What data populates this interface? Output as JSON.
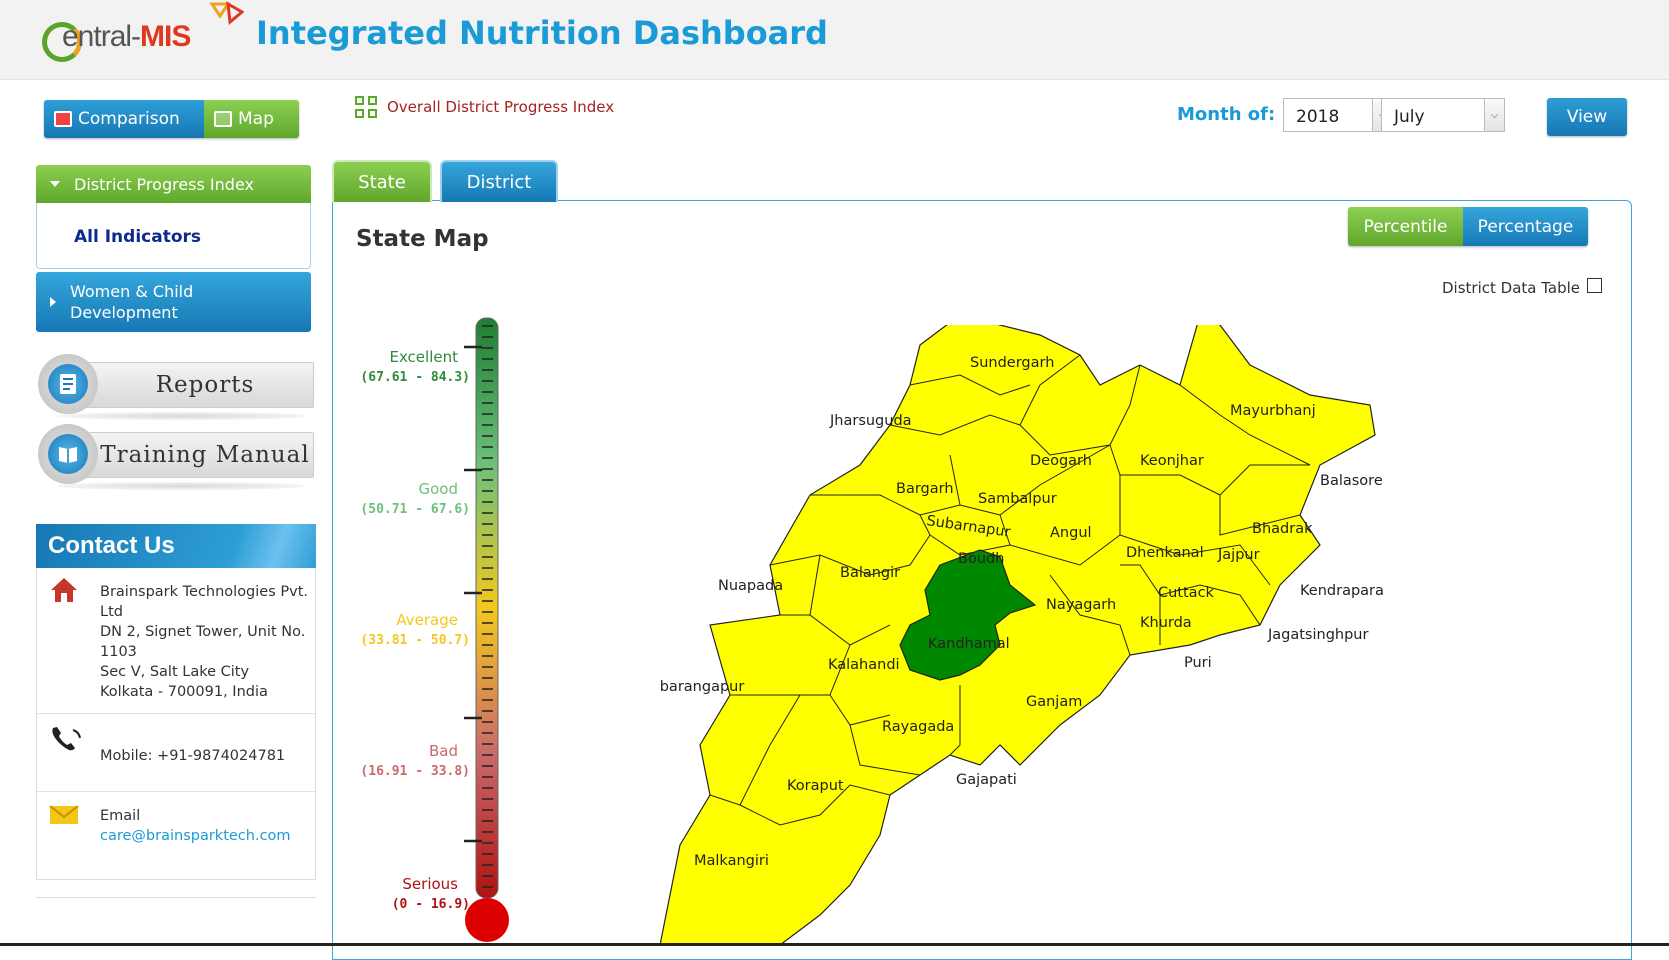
{
  "header": {
    "logo_prefix": "entral-",
    "logo_suffix": "MIS",
    "title": "Integrated Nutrition Dashboard"
  },
  "toolbar": {
    "comparison_label": "Comparison",
    "map_label": "Map",
    "overall_link": "Overall District Progress Index",
    "month_label": "Month of:",
    "year_value": "2018",
    "month_value": "July",
    "view_label": "View"
  },
  "sidebar": {
    "dpi_label": "District Progress Index",
    "all_indicators": "All Indicators",
    "wcd_line1": "Women & Child",
    "wcd_line2": "Development",
    "reports_label": "Reports",
    "training_label": "Training Manual"
  },
  "contact": {
    "title": "Contact Us",
    "address_lines": [
      "Brainspark Technologies Pvt.",
      "Ltd",
      "DN 2, Signet Tower, Unit No.",
      "1103",
      "Sec V, Salt Lake City",
      "Kolkata - 700091, India"
    ],
    "mobile": "Mobile: +91-9874024781",
    "email_label": "Email",
    "email": "care@brainsparktech.com"
  },
  "tabs": {
    "state": "State",
    "district": "District"
  },
  "panel": {
    "title": "State Map",
    "percentile": "Percentile",
    "percentage": "Percentage",
    "district_data_table": "District Data Table"
  },
  "legend": [
    {
      "label": "Excellent",
      "range": "(67.61 - 84.3)",
      "color": "#2e8b3a"
    },
    {
      "label": "Good",
      "range": "(50.71 - 67.6)",
      "color": "#6cc07a"
    },
    {
      "label": "Average",
      "range": "(33.81 - 50.7)",
      "color": "#f2c81e"
    },
    {
      "label": "Bad",
      "range": "(16.91 - 33.8)",
      "color": "#c96a6a"
    },
    {
      "label": "Serious",
      "range": "(0 - 16.9)",
      "color": "#b01212"
    }
  ],
  "map": {
    "default_fill": "#ffff00",
    "highlight_fill": "#008800",
    "highlight_district": "Kandhamal",
    "districts": [
      "Sundergarh",
      "Jharsuguda",
      "Mayurbhanj",
      "Deogarh",
      "Keonjhar",
      "Balasore",
      "Bargarh",
      "Sambalpur",
      "Subarnapur",
      "Angul",
      "Dhenkanal",
      "Bhadrak",
      "Jajpur",
      "Balangir",
      "Boudh",
      "Nuapada",
      "Cuttack",
      "Kendrapara",
      "Nayagarh",
      "Khurda",
      "Kandhamal",
      "Jagatsinghpur",
      "Kalahandi",
      "Puri",
      "Nabarangapur",
      "Ganjam",
      "Rayagada",
      "Koraput",
      "Gajapati",
      "Malkangiri"
    ]
  }
}
